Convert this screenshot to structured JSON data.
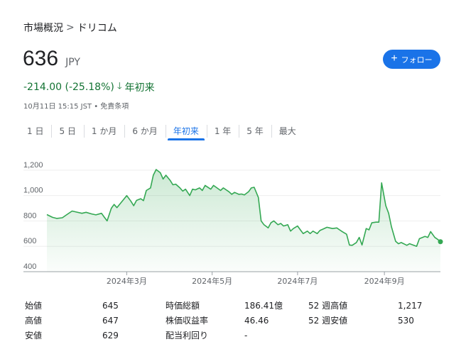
{
  "breadcrumb": {
    "parent": "市場概況",
    "separator": ">",
    "current": "ドリコム"
  },
  "quote": {
    "price": "636",
    "currency": "JPY",
    "change": "-214.00 (-25.18%)",
    "change_arrow": "🡓",
    "period": "年初来",
    "timestamp": "10月11日 15:15 JST • 免責条項"
  },
  "follow_button": {
    "icon": "+",
    "label": "フォロー"
  },
  "tabs": [
    {
      "label": "1 日",
      "active": false
    },
    {
      "label": "5 日",
      "active": false
    },
    {
      "label": "1 か月",
      "active": false
    },
    {
      "label": "6 か月",
      "active": false
    },
    {
      "label": "年初来",
      "active": true
    },
    {
      "label": "1 年",
      "active": false
    },
    {
      "label": "5 年",
      "active": false
    },
    {
      "label": "最大",
      "active": false
    }
  ],
  "colors": {
    "accent": "#1a73e8",
    "positive_line": "#34a853",
    "change_text": "#137333"
  },
  "chart_data": {
    "type": "area",
    "y_ticks": [
      "1,200",
      "1,000",
      "800",
      "600",
      "400"
    ],
    "ylim": [
      400,
      1300
    ],
    "x_labels": [
      "2024年3月",
      "2024年5月",
      "2024年7月",
      "2024年9月"
    ],
    "x_label_dates": [
      "2024-03-01",
      "2024-05-01",
      "2024-07-01",
      "2024-09-01"
    ],
    "x_range": [
      "2024-01-04",
      "2024-10-11"
    ],
    "grid": true,
    "points": [
      [
        "2024-01-04",
        850
      ],
      [
        "2024-01-08",
        828
      ],
      [
        "2024-01-11",
        820
      ],
      [
        "2024-01-15",
        825
      ],
      [
        "2024-01-18",
        848
      ],
      [
        "2024-01-22",
        878
      ],
      [
        "2024-01-25",
        870
      ],
      [
        "2024-01-29",
        860
      ],
      [
        "2024-02-01",
        868
      ],
      [
        "2024-02-05",
        855
      ],
      [
        "2024-02-08",
        848
      ],
      [
        "2024-02-12",
        860
      ],
      [
        "2024-02-14",
        830
      ],
      [
        "2024-02-16",
        800
      ],
      [
        "2024-02-19",
        900
      ],
      [
        "2024-02-21",
        930
      ],
      [
        "2024-02-23",
        905
      ],
      [
        "2024-02-26",
        945
      ],
      [
        "2024-02-28",
        972
      ],
      [
        "2024-03-01",
        1000
      ],
      [
        "2024-03-04",
        955
      ],
      [
        "2024-03-06",
        920
      ],
      [
        "2024-03-08",
        962
      ],
      [
        "2024-03-11",
        975
      ],
      [
        "2024-03-13",
        960
      ],
      [
        "2024-03-15",
        1040
      ],
      [
        "2024-03-18",
        1060
      ],
      [
        "2024-03-20",
        1160
      ],
      [
        "2024-03-22",
        1205
      ],
      [
        "2024-03-25",
        1180
      ],
      [
        "2024-03-27",
        1130
      ],
      [
        "2024-03-29",
        1160
      ],
      [
        "2024-04-01",
        1120
      ],
      [
        "2024-04-03",
        1085
      ],
      [
        "2024-04-05",
        1090
      ],
      [
        "2024-04-08",
        1060
      ],
      [
        "2024-04-10",
        1035
      ],
      [
        "2024-04-12",
        1050
      ],
      [
        "2024-04-15",
        1000
      ],
      [
        "2024-04-17",
        1050
      ],
      [
        "2024-04-19",
        1045
      ],
      [
        "2024-04-22",
        1060
      ],
      [
        "2024-04-24",
        1040
      ],
      [
        "2024-04-26",
        1080
      ],
      [
        "2024-04-30",
        1050
      ],
      [
        "2024-05-02",
        1080
      ],
      [
        "2024-05-07",
        1040
      ],
      [
        "2024-05-09",
        1060
      ],
      [
        "2024-05-13",
        1030
      ],
      [
        "2024-05-15",
        1010
      ],
      [
        "2024-05-17",
        1025
      ],
      [
        "2024-05-20",
        1010
      ],
      [
        "2024-05-22",
        1012
      ],
      [
        "2024-05-24",
        1005
      ],
      [
        "2024-05-27",
        1030
      ],
      [
        "2024-05-29",
        1060
      ],
      [
        "2024-05-31",
        1065
      ],
      [
        "2024-06-03",
        985
      ],
      [
        "2024-06-05",
        800
      ],
      [
        "2024-06-07",
        770
      ],
      [
        "2024-06-10",
        745
      ],
      [
        "2024-06-12",
        785
      ],
      [
        "2024-06-14",
        800
      ],
      [
        "2024-06-17",
        770
      ],
      [
        "2024-06-19",
        780
      ],
      [
        "2024-06-21",
        760
      ],
      [
        "2024-06-24",
        770
      ],
      [
        "2024-06-26",
        720
      ],
      [
        "2024-06-28",
        740
      ],
      [
        "2024-07-01",
        760
      ],
      [
        "2024-07-03",
        730
      ],
      [
        "2024-07-05",
        700
      ],
      [
        "2024-07-08",
        720
      ],
      [
        "2024-07-10",
        700
      ],
      [
        "2024-07-12",
        720
      ],
      [
        "2024-07-15",
        700
      ],
      [
        "2024-07-17",
        725
      ],
      [
        "2024-07-19",
        735
      ],
      [
        "2024-07-22",
        750
      ],
      [
        "2024-07-24",
        745
      ],
      [
        "2024-07-26",
        740
      ],
      [
        "2024-07-29",
        745
      ],
      [
        "2024-07-31",
        730
      ],
      [
        "2024-08-02",
        715
      ],
      [
        "2024-08-05",
        695
      ],
      [
        "2024-08-07",
        610
      ],
      [
        "2024-08-09",
        608
      ],
      [
        "2024-08-12",
        630
      ],
      [
        "2024-08-14",
        670
      ],
      [
        "2024-08-16",
        610
      ],
      [
        "2024-08-19",
        740
      ],
      [
        "2024-08-21",
        730
      ],
      [
        "2024-08-23",
        785
      ],
      [
        "2024-08-26",
        790
      ],
      [
        "2024-08-28",
        790
      ],
      [
        "2024-08-30",
        1100
      ],
      [
        "2024-09-02",
        920
      ],
      [
        "2024-09-04",
        860
      ],
      [
        "2024-09-06",
        755
      ],
      [
        "2024-09-09",
        640
      ],
      [
        "2024-09-11",
        620
      ],
      [
        "2024-09-13",
        630
      ],
      [
        "2024-09-17",
        608
      ],
      [
        "2024-09-19",
        620
      ],
      [
        "2024-09-24",
        600
      ],
      [
        "2024-09-26",
        660
      ],
      [
        "2024-09-30",
        678
      ],
      [
        "2024-10-02",
        670
      ],
      [
        "2024-10-04",
        716
      ],
      [
        "2024-10-07",
        670
      ],
      [
        "2024-10-09",
        655
      ],
      [
        "2024-10-11",
        636
      ]
    ]
  },
  "stats": {
    "rows": [
      [
        [
          "始値",
          "645"
        ],
        [
          "時価総額",
          "186.41億"
        ],
        [
          "52 週高値",
          "1,217"
        ]
      ],
      [
        [
          "高値",
          "647"
        ],
        [
          "株価収益率",
          "46.46"
        ],
        [
          "52 週安値",
          "530"
        ]
      ],
      [
        [
          "安値",
          "629"
        ],
        [
          "配当利回り",
          "-"
        ],
        [
          "",
          ""
        ]
      ]
    ]
  }
}
